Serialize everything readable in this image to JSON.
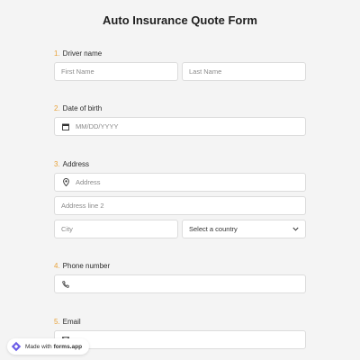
{
  "form": {
    "title": "Auto Insurance Quote Form"
  },
  "questions": [
    {
      "num": "1.",
      "label": "Driver name"
    },
    {
      "num": "2.",
      "label": "Date of birth"
    },
    {
      "num": "3.",
      "label": "Address"
    },
    {
      "num": "4.",
      "label": "Phone number"
    },
    {
      "num": "5.",
      "label": "Email"
    }
  ],
  "fields": {
    "first_name": "First Name",
    "last_name": "Last Name",
    "dob": "MM/DD/YYYY",
    "address": "Address",
    "address2": "Address line 2",
    "city": "City",
    "country": "Select a country",
    "phone": "",
    "email": ""
  },
  "badge": {
    "made_with": "Made with",
    "brand": "forms.app"
  },
  "colors": {
    "accent_number": "#e8a23a",
    "badge_logo": "#6b5ce7"
  },
  "icons": [
    "calendar-icon",
    "location-pin-icon",
    "phone-icon",
    "mail-icon",
    "chevron-down-icon"
  ]
}
